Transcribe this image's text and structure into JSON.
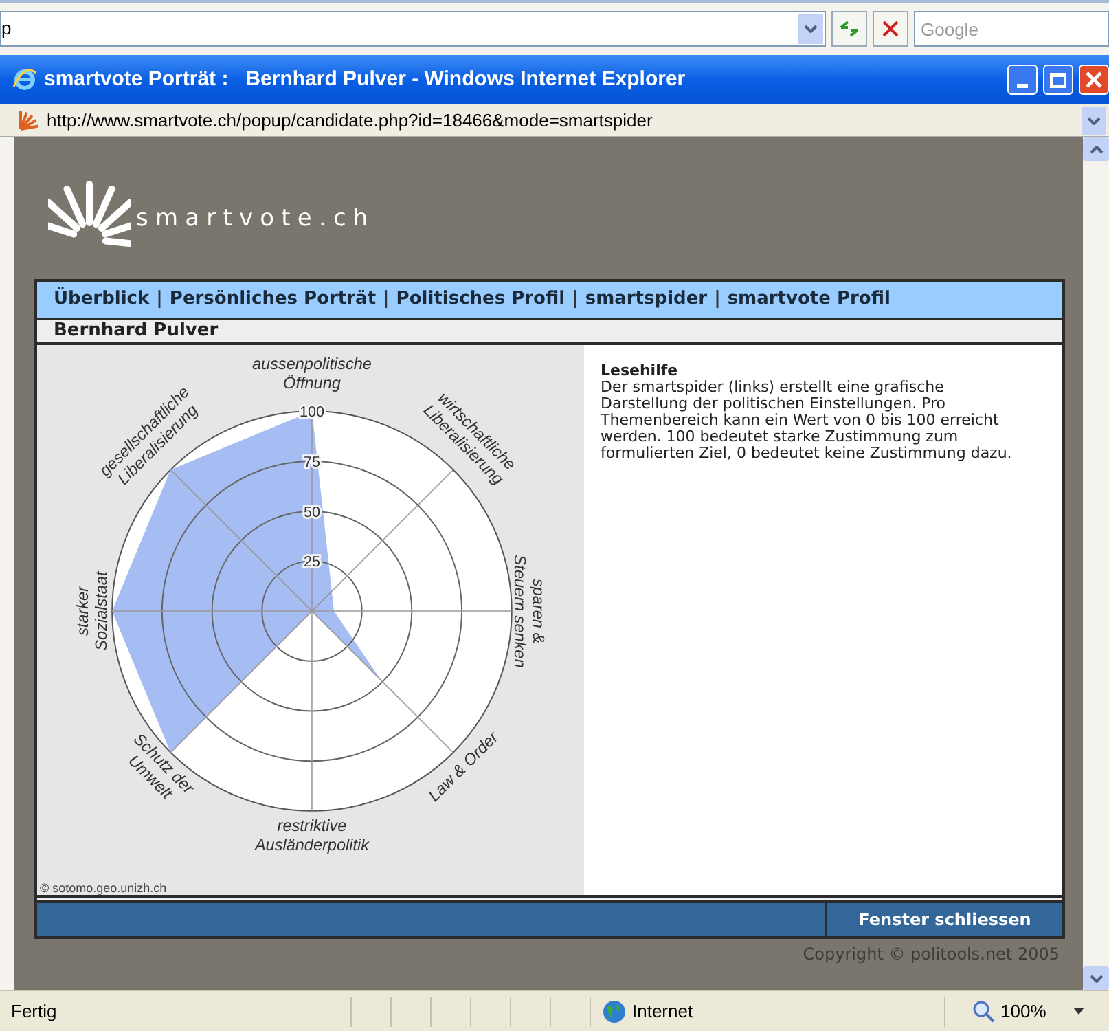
{
  "browser_toolbar": {
    "address_fragment": "p",
    "search": {
      "placeholder": "Google"
    }
  },
  "window": {
    "title": "smartvote Porträt :   Bernhard Pulver - Windows Internet Explorer"
  },
  "address_bar": {
    "url": "http://www.smartvote.ch/popup/candidate.php?id=18466&mode=smartspider"
  },
  "page": {
    "logo": "smartvote.ch",
    "nav": [
      {
        "kind": "link",
        "label": "Überblick"
      },
      {
        "kind": "separator",
        "label": "|"
      },
      {
        "kind": "link",
        "label": "Persönliches Porträt"
      },
      {
        "kind": "separator",
        "label": "|"
      },
      {
        "kind": "link",
        "label": "Politisches Profil"
      },
      {
        "kind": "separator",
        "label": "|"
      },
      {
        "kind": "link",
        "label": "smartspider"
      },
      {
        "kind": "separator",
        "label": "|"
      },
      {
        "kind": "link",
        "label": "smartvote Profil"
      }
    ],
    "candidate_name": "Bernhard Pulver",
    "spider": {
      "axis_labels": [
        "aussenpolitische\nÖffnung",
        "wirtschaftliche\nLiberalisierung",
        "sparen &\nSteuern senken",
        "Law & Order",
        "restriktive\nAusländerpolitik",
        "Schutz der\nUmwelt",
        "starker\nSozialstaat",
        "gesellschaftliche\nLiberalisierung"
      ],
      "ring_labels": [
        "100",
        "75",
        "50",
        "25"
      ]
    },
    "chart_credit": "© sotomo.geo.unizh.ch",
    "help": {
      "title": "Lesehilfe",
      "text": "Der smartspider (links) erstellt eine grafische Darstellung der politischen Einstellungen. Pro Themenbereich kann ein Wert von 0 bis 100 erreicht werden. 100 bedeutet starke Zustimmung zum formulierten Ziel, 0 bedeutet keine Zustimmung dazu."
    },
    "close_button": "Fenster schliessen",
    "copyright": "Copyright © politools.net 2005"
  },
  "status_bar": {
    "status": "Fertig",
    "zone": "Internet",
    "zoom": "100%"
  }
}
